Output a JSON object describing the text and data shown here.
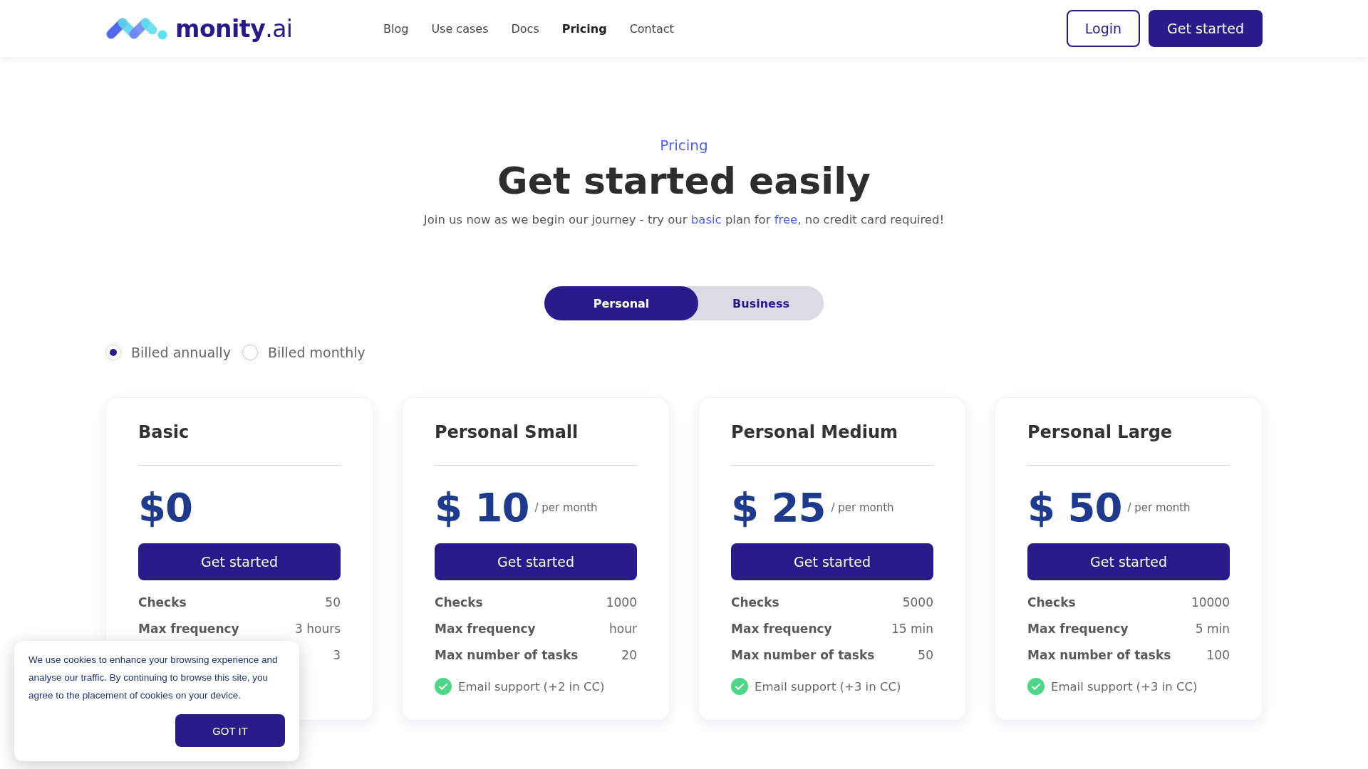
{
  "header": {
    "logo": "**monity**.ai",
    "nav": [
      {
        "label": "Blog",
        "selected": false
      },
      {
        "label": "Use cases",
        "selected": false
      },
      {
        "label": "Docs",
        "selected": false
      },
      {
        "label": "Pricing",
        "selected": true
      },
      {
        "label": "Contact",
        "selected": false
      }
    ],
    "login": "Login",
    "cta": "Get started"
  },
  "hero": {
    "eyebrow": "Pricing",
    "title": "Get started easily",
    "subtitle": [
      {
        "kind": "text",
        "text": "Join us now as we begin our journey - try our "
      },
      {
        "kind": "link",
        "text": "basic"
      },
      {
        "kind": "text",
        "text": " plan for "
      },
      {
        "kind": "link",
        "text": "free"
      },
      {
        "kind": "text",
        "text": ", no credit card required!"
      }
    ]
  },
  "plan_tabs": [
    {
      "label": "Personal",
      "selected": true
    },
    {
      "label": "Business",
      "selected": false
    }
  ],
  "billing": [
    {
      "label": "Billed annually",
      "selected": true
    },
    {
      "label": "Billed monthly",
      "selected": false
    }
  ],
  "plans": [
    {
      "name": "Basic",
      "price": "$0",
      "button": "Get started",
      "rows": [
        {
          "label": "Checks",
          "value": "50"
        },
        {
          "label": "Max frequency",
          "value": "3 hours"
        },
        {
          "value": "3"
        }
      ]
    },
    {
      "name": "Personal Small",
      "price": "$ 10",
      "period": "/ per month",
      "button": "Get started",
      "rows": [
        {
          "label": "Checks",
          "value": "1000"
        },
        {
          "label": "Max frequency",
          "value": "hour"
        },
        {
          "label": "Max number of tasks",
          "value": "20"
        }
      ],
      "features": [
        "Email support (+2 in CC)"
      ]
    },
    {
      "name": "Personal Medium",
      "price": "$ 25",
      "period": "/ per month",
      "button": "Get started",
      "rows": [
        {
          "label": "Checks",
          "value": "5000"
        },
        {
          "label": "Max frequency",
          "value": "15 min"
        },
        {
          "label": "Max number of tasks",
          "value": "50"
        }
      ],
      "features": [
        "Email support (+3 in CC)"
      ]
    },
    {
      "name": "Personal Large",
      "price": "$ 50",
      "period": "/ per month",
      "button": "Get started",
      "rows": [
        {
          "label": "Checks",
          "value": "10000"
        },
        {
          "label": "Max frequency",
          "value": "5 min"
        },
        {
          "label": "Max number of tasks",
          "value": "100"
        }
      ],
      "features": [
        "Email support (+3 in CC)"
      ]
    }
  ],
  "cookie_banner": {
    "text": "We use cookies to enhance your browsing experience and analyse our traffic. By continuing to browse this site, you agree to the placement of cookies on your device.",
    "button": "GOT IT"
  }
}
